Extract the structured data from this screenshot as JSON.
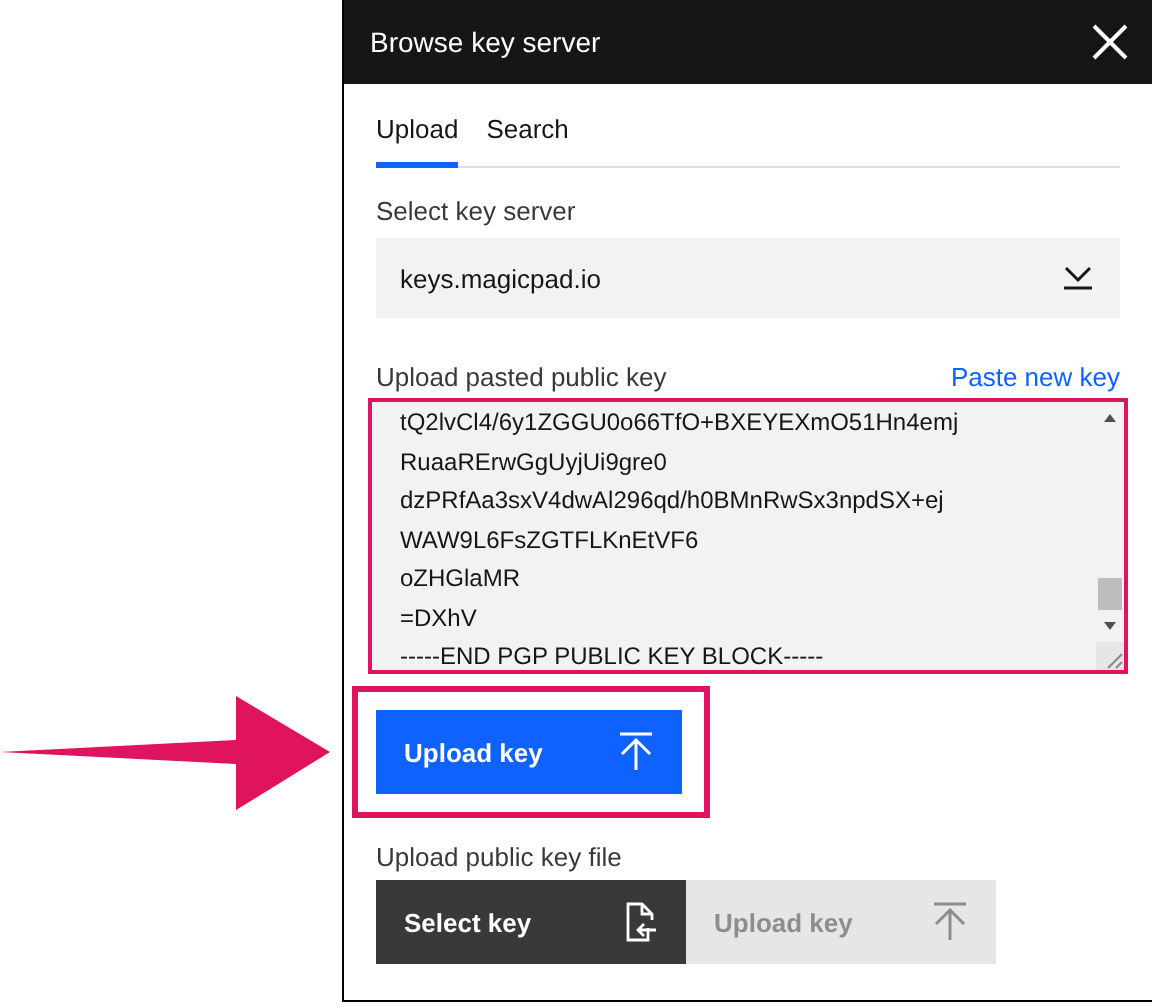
{
  "window": {
    "title": "Browse key server"
  },
  "tabs": [
    {
      "label": "Upload",
      "selected": true
    },
    {
      "label": "Search",
      "selected": false
    }
  ],
  "key_server": {
    "label": "Select key server",
    "value": "keys.magicpad.io"
  },
  "pasted_key": {
    "label": "Upload pasted public key",
    "link": "Paste new key",
    "highlighted": true,
    "lines": [
      "tQ2lvCl4/6y1ZGGU0o66TfO+BXEYEXmO51Hn4emj",
      "RuaaRErwGgUyjUi9gre0",
      "dzPRfAa3sxV4dwAl296qd/h0BMnRwSx3npdSX+ej",
      "WAW9L6FsZGTFLKnEtVF6",
      "oZHGlaMR",
      "=DXhV",
      "-----END PGP PUBLIC KEY BLOCK-----"
    ]
  },
  "upload_button": {
    "label": "Upload key",
    "highlighted": true,
    "disabled": false
  },
  "file_section": {
    "label": "Upload public key file",
    "buttons": [
      {
        "kind": "select",
        "label": "Select key",
        "disabled": false
      },
      {
        "kind": "upload",
        "label": "Upload key",
        "disabled": true
      }
    ]
  }
}
